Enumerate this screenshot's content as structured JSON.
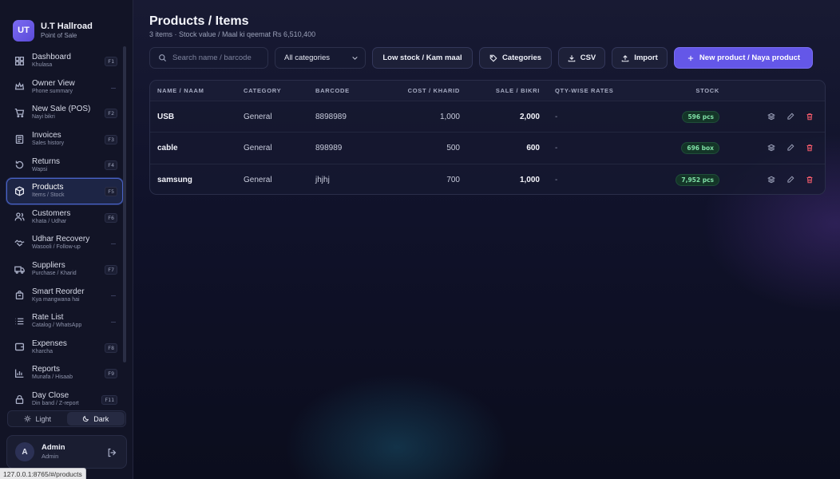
{
  "brand": {
    "initials": "UT",
    "name": "U.T Hallroad",
    "subtitle": "Point of Sale"
  },
  "sidebar": {
    "items": [
      {
        "label": "Dashboard",
        "sub": "Khulasa",
        "key": "F1",
        "icon": "dashboard-icon"
      },
      {
        "label": "Owner View",
        "sub": "Phone summary",
        "key": "",
        "icon": "crown-icon"
      },
      {
        "label": "New Sale (POS)",
        "sub": "Nayi bikri",
        "key": "F2",
        "icon": "cart-icon"
      },
      {
        "label": "Invoices",
        "sub": "Sales history",
        "key": "F3",
        "icon": "invoice-icon"
      },
      {
        "label": "Returns",
        "sub": "Wapsi",
        "key": "F4",
        "icon": "return-icon"
      },
      {
        "label": "Products",
        "sub": "Items / Stock",
        "key": "F5",
        "icon": "box-icon",
        "active": true
      },
      {
        "label": "Customers",
        "sub": "Khata / Udhar",
        "key": "F6",
        "icon": "users-icon"
      },
      {
        "label": "Udhar Recovery",
        "sub": "Wasooli / Follow-up",
        "key": "",
        "icon": "handshake-icon"
      },
      {
        "label": "Suppliers",
        "sub": "Purchase / Kharid",
        "key": "F7",
        "icon": "truck-icon"
      },
      {
        "label": "Smart Reorder",
        "sub": "Kya mangwana hai",
        "key": "",
        "icon": "bag-icon"
      },
      {
        "label": "Rate List",
        "sub": "Catalog / WhatsApp",
        "key": "",
        "icon": "list-icon"
      },
      {
        "label": "Expenses",
        "sub": "Kharcha",
        "key": "F8",
        "icon": "wallet-icon"
      },
      {
        "label": "Reports",
        "sub": "Munafa / Hisaab",
        "key": "F9",
        "icon": "chart-icon"
      },
      {
        "label": "Day Close",
        "sub": "Din band / Z-report",
        "key": "F11",
        "icon": "lock-icon"
      }
    ]
  },
  "theme": {
    "light": "Light",
    "dark": "Dark",
    "selected": "dark"
  },
  "user": {
    "initial": "A",
    "name": "Admin",
    "role": "Admin"
  },
  "status_url": "127.0.0.1:8765/#/products",
  "page": {
    "title": "Products / Items",
    "subtitle": "3 items · Stock value / Maal ki qeemat Rs 6,510,400"
  },
  "toolbar": {
    "search_placeholder": "Search name / barcode",
    "category_select": "All categories",
    "low_stock": "Low stock / Kam maal",
    "categories": "Categories",
    "csv": "CSV",
    "import": "Import",
    "new_product": "New product / Naya product"
  },
  "table": {
    "headers": {
      "name": "NAME / NAAM",
      "category": "CATEGORY",
      "barcode": "BARCODE",
      "cost": "COST / KHARID",
      "sale": "SALE / BIKRI",
      "qty": "QTY-WISE RATES",
      "stock": "STOCK"
    },
    "rows": [
      {
        "name": "USB",
        "category": "General",
        "barcode": "8898989",
        "cost": "1,000",
        "sale": "2,000",
        "qty": "-",
        "stock": "596 pcs"
      },
      {
        "name": "cable",
        "category": "General",
        "barcode": "898989",
        "cost": "500",
        "sale": "600",
        "qty": "-",
        "stock": "696 box"
      },
      {
        "name": "samsung",
        "category": "General",
        "barcode": "jhjhj",
        "cost": "700",
        "sale": "1,000",
        "qty": "-",
        "stock": "7,952 pcs"
      }
    ]
  },
  "colors": {
    "accent": "#6457e8",
    "active_border": "#4a63c9",
    "stock_badge": "#7fe0a6",
    "danger": "#ef5a6a"
  }
}
